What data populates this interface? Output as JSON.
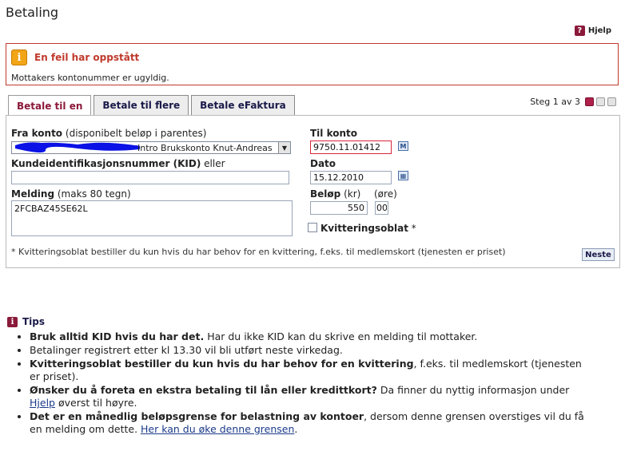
{
  "page": {
    "title": "Betaling",
    "help": "Hjelp"
  },
  "error": {
    "title": "En feil har oppstått",
    "message": "Mottakers kontonummer er ugyldig."
  },
  "tabs": [
    {
      "label": "Betale til en",
      "active": true
    },
    {
      "label": "Betale til flere",
      "active": false
    },
    {
      "label": "Betale eFaktura",
      "active": false
    }
  ],
  "step": {
    "label": "Steg 1 av 3",
    "current": 1,
    "total": 3
  },
  "form": {
    "from_account": {
      "label": "Fra konto",
      "hint": "(disponibelt beløp i parentes)",
      "selected": "Intro Brukskonto Knut-Andreas"
    },
    "kid": {
      "label": "Kundeidentifikasjonsnummer (KID)",
      "hint": "eller",
      "value": ""
    },
    "message": {
      "label": "Melding",
      "hint": "(maks 80 tegn)",
      "value": "2FCBAZ45SE62L"
    },
    "to_account": {
      "label": "Til konto",
      "value": "9750.11.01412"
    },
    "date": {
      "label": "Dato",
      "value": "15.12.2010"
    },
    "amount": {
      "label": "Beløp",
      "kr_hint": "(kr)",
      "ore_hint": "(øre)",
      "kr_value": "550",
      "ore_value": "00"
    },
    "receipt": {
      "label": "Kvitteringsoblat",
      "asterisk": "*",
      "checked": false
    },
    "footnote": "* Kvitteringsoblat bestiller du kun hvis du har behov for en kvittering, f.eks. til medlemskort (tjenesten er priset)",
    "next_button": "Neste"
  },
  "tips": {
    "title": "Tips",
    "items": [
      {
        "bold": "Bruk alltid KID hvis du har det.",
        "text": " Har du ikke KID kan du skrive en melding til mottaker."
      },
      {
        "bold": "",
        "text": "Betalinger registrert etter kl 13.30 vil bli utført neste virkedag."
      },
      {
        "bold": "Kvitteringsoblat bestiller du kun hvis du har behov for en kvittering",
        "text": ", f.eks. til medlemskort (tjenesten er priset)."
      },
      {
        "bold": "Ønsker du å foreta en ekstra betaling til lån eller kredittkort?",
        "text": " Da finner du nyttig informasjon under ",
        "link": "Hjelp",
        "after": " øverst til høyre."
      },
      {
        "bold": "Det er en månedlig beløpsgrense for belastning av kontoer",
        "text": ", dersom denne grensen overstiges vil du få en melding om dette. ",
        "link": "Her kan du øke denne grensen",
        "after": "."
      }
    ]
  },
  "colors": {
    "accent": "#8b1a3a",
    "error": "#c0392b",
    "link": "#1a3a8a"
  }
}
